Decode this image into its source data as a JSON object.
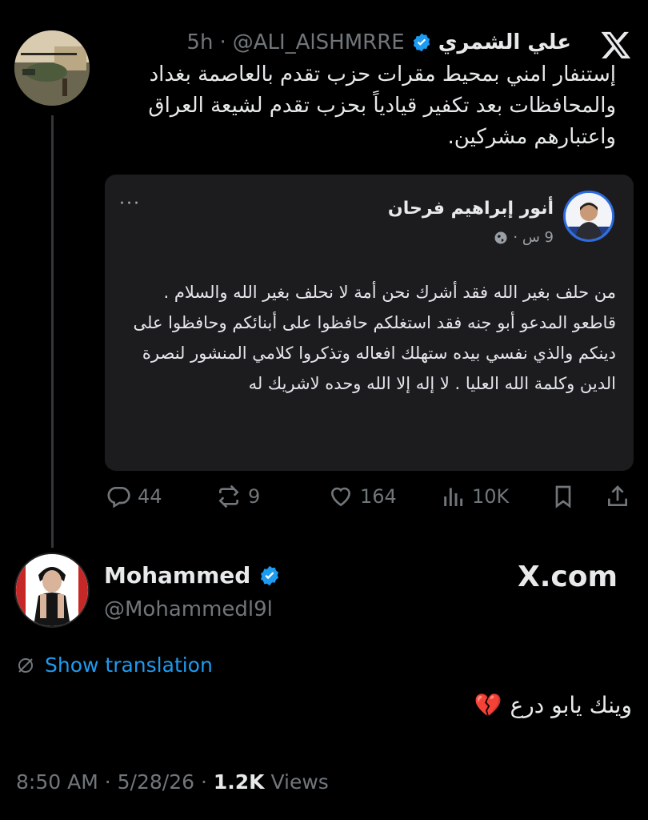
{
  "tweet": {
    "author_name": "علي الشمري",
    "handle": "@ALI_AlSHMRRE",
    "separator": "·",
    "time": "5h",
    "text": "إستنفار امني بمحيط مقرات حزب تقدم بالعاصمة بغداد والمحافظات بعد تكفير قيادياً بحزب تقدم لشيعة العراق واعتبارهم مشركين.",
    "quoted": {
      "author_name": "أنور إبراهيم فرحان",
      "meta": "9 س ·",
      "more": "···",
      "body": "من حلف بغير الله فقد أشرك نحن أمة لا نحلف بغير الله والسلام . قاطعو المدعو أبو جنه فقد استغلكم حافظوا على أبنائكم وحافظوا على دينكم والذي نفسي بيده ستهلك افعاله وتذكروا كلامي المنشور لنصرة الدين وكلمة الله العليا . لا إله إلا الله وحده لاشريك له"
    },
    "actions": {
      "replies": "44",
      "reposts": "9",
      "likes": "164",
      "views": "10K"
    }
  },
  "reply": {
    "author_name": "Mohammed",
    "handle": "@Mohammedl9l",
    "watermark": "X.com",
    "show_translation": "Show translation",
    "text": "وينك يابو درع",
    "emoji": "💔"
  },
  "footer": {
    "time": "8:50 AM",
    "date": "5/28/26",
    "views_count": "1.2K",
    "views_label": "Views"
  },
  "colors": {
    "background": "#000000",
    "accent": "#1d9bf0",
    "muted": "#71767b",
    "card": "#1c1c1f"
  },
  "icons": [
    "x-logo-icon",
    "verified-badge-icon",
    "globe-icon",
    "reply-icon",
    "repost-icon",
    "like-icon",
    "views-icon",
    "bookmark-icon",
    "share-icon",
    "translate-icon"
  ]
}
